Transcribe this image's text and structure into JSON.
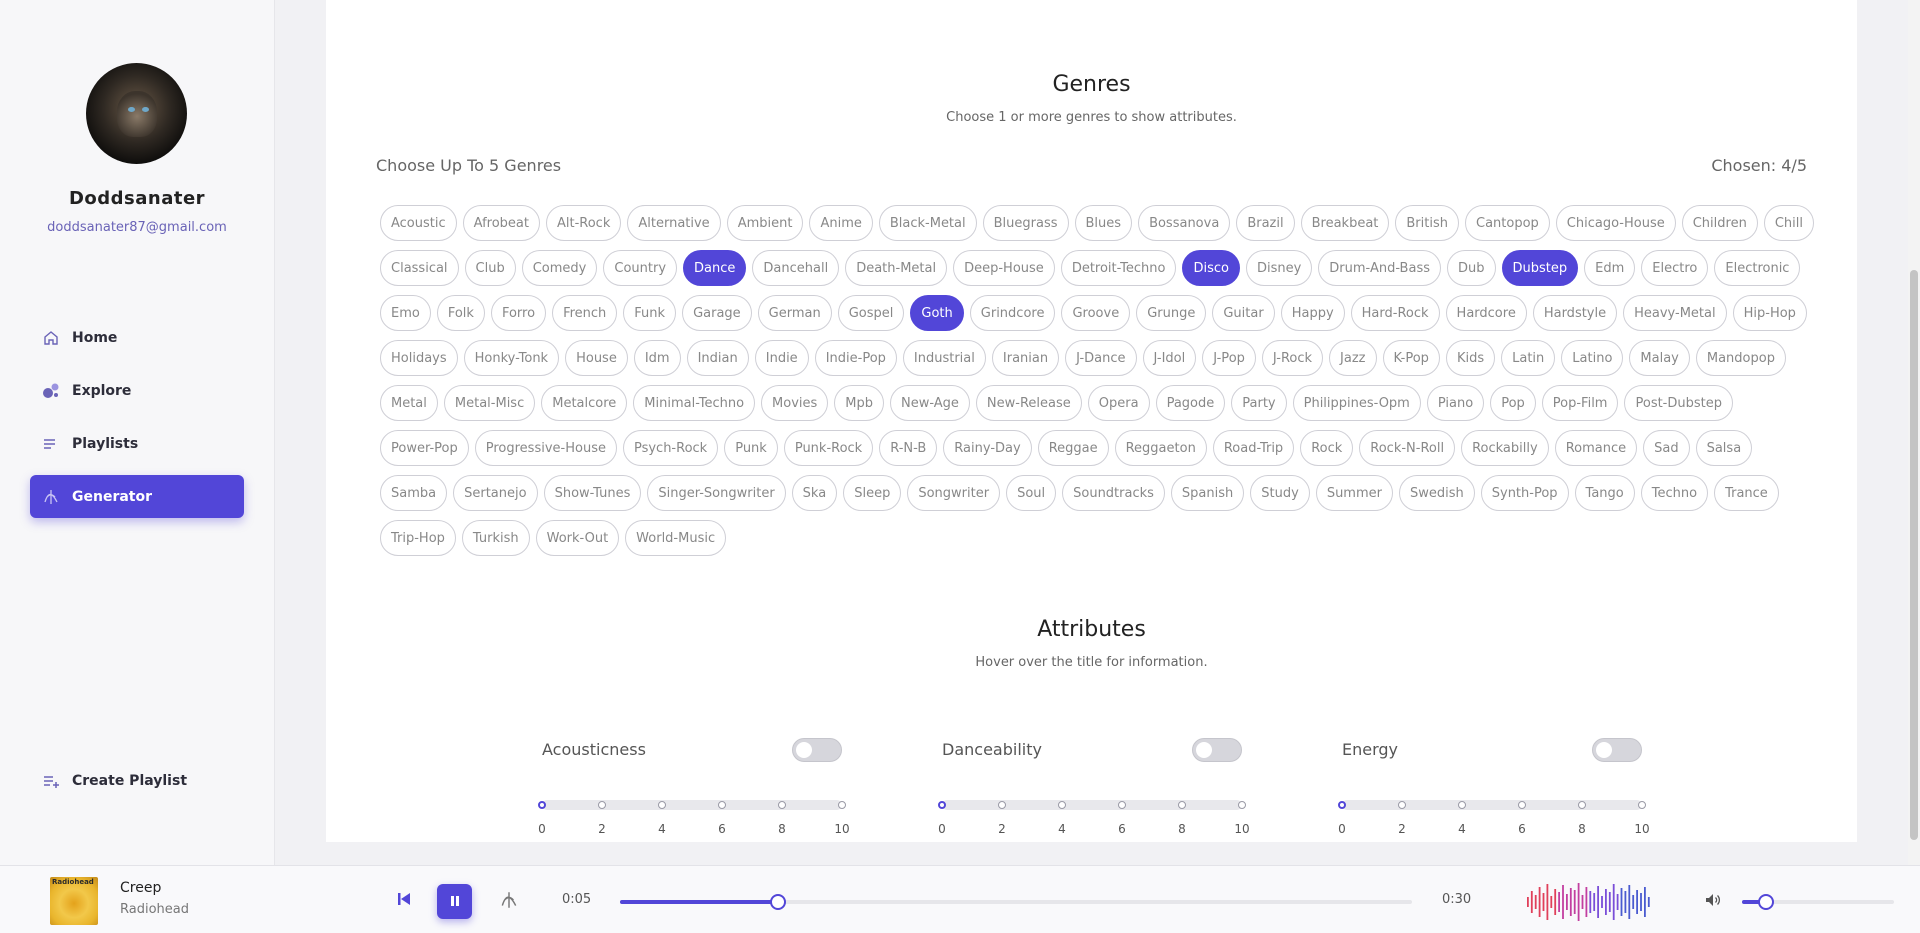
{
  "profile": {
    "username": "Doddsanater",
    "email": "doddsanater87@gmail.com"
  },
  "nav": {
    "items": [
      {
        "label": "Home",
        "icon": "home-icon",
        "active": false
      },
      {
        "label": "Explore",
        "icon": "explore-icon",
        "active": false
      },
      {
        "label": "Playlists",
        "icon": "playlists-icon",
        "active": false
      },
      {
        "label": "Generator",
        "icon": "generator-icon",
        "active": true
      }
    ],
    "create_playlist": "Create Playlist"
  },
  "genres": {
    "title": "Genres",
    "subtitle": "Choose 1 or more genres to show attributes.",
    "choose_label": "Choose Up To 5 Genres",
    "chosen_label": "Chosen: 4/5",
    "selected": [
      "Dance",
      "Disco",
      "Dubstep",
      "Goth"
    ],
    "list": [
      "Acoustic",
      "Afrobeat",
      "Alt-Rock",
      "Alternative",
      "Ambient",
      "Anime",
      "Black-Metal",
      "Bluegrass",
      "Blues",
      "Bossanova",
      "Brazil",
      "Breakbeat",
      "British",
      "Cantopop",
      "Chicago-House",
      "Children",
      "Chill",
      "Classical",
      "Club",
      "Comedy",
      "Country",
      "Dance",
      "Dancehall",
      "Death-Metal",
      "Deep-House",
      "Detroit-Techno",
      "Disco",
      "Disney",
      "Drum-And-Bass",
      "Dub",
      "Dubstep",
      "Edm",
      "Electro",
      "Electronic",
      "Emo",
      "Folk",
      "Forro",
      "French",
      "Funk",
      "Garage",
      "German",
      "Gospel",
      "Goth",
      "Grindcore",
      "Groove",
      "Grunge",
      "Guitar",
      "Happy",
      "Hard-Rock",
      "Hardcore",
      "Hardstyle",
      "Heavy-Metal",
      "Hip-Hop",
      "Holidays",
      "Honky-Tonk",
      "House",
      "Idm",
      "Indian",
      "Indie",
      "Indie-Pop",
      "Industrial",
      "Iranian",
      "J-Dance",
      "J-Idol",
      "J-Pop",
      "J-Rock",
      "Jazz",
      "K-Pop",
      "Kids",
      "Latin",
      "Latino",
      "Malay",
      "Mandopop",
      "Metal",
      "Metal-Misc",
      "Metalcore",
      "Minimal-Techno",
      "Movies",
      "Mpb",
      "New-Age",
      "New-Release",
      "Opera",
      "Pagode",
      "Party",
      "Philippines-Opm",
      "Piano",
      "Pop",
      "Pop-Film",
      "Post-Dubstep",
      "Power-Pop",
      "Progressive-House",
      "Psych-Rock",
      "Punk",
      "Punk-Rock",
      "R-N-B",
      "Rainy-Day",
      "Reggae",
      "Reggaeton",
      "Road-Trip",
      "Rock",
      "Rock-N-Roll",
      "Rockabilly",
      "Romance",
      "Sad",
      "Salsa",
      "Samba",
      "Sertanejo",
      "Show-Tunes",
      "Singer-Songwriter",
      "Ska",
      "Sleep",
      "Songwriter",
      "Soul",
      "Soundtracks",
      "Spanish",
      "Study",
      "Summer",
      "Swedish",
      "Synth-Pop",
      "Tango",
      "Techno",
      "Trance",
      "Trip-Hop",
      "Turkish",
      "Work-Out",
      "World-Music"
    ]
  },
  "attributes": {
    "title": "Attributes",
    "subtitle": "Hover over the title for information.",
    "items": [
      {
        "name": "Acousticness",
        "enabled": false,
        "value": 0
      },
      {
        "name": "Danceability",
        "enabled": false,
        "value": 0
      },
      {
        "name": "Energy",
        "enabled": false,
        "value": 0
      }
    ],
    "scale": [
      "0",
      "2",
      "4",
      "6",
      "8",
      "10"
    ]
  },
  "player": {
    "track_title": "Creep",
    "track_artist": "Radiohead",
    "cover_text": "Radiohead",
    "elapsed": "0:05",
    "duration": "0:30",
    "progress_fraction": 0.2,
    "volume_fraction": 0.16
  },
  "colors": {
    "accent": "#5246d8",
    "wave": [
      "#e0405a",
      "#c23fa0",
      "#7a4ed8",
      "#4a5bd0"
    ]
  }
}
